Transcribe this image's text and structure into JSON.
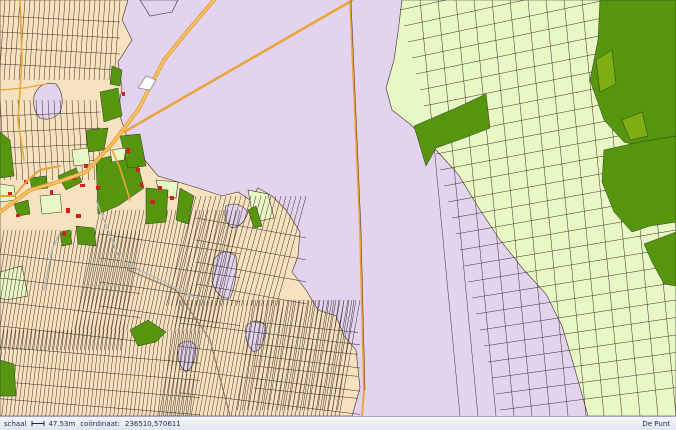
{
  "colors": {
    "water": "#e3d3ef",
    "parcel_tan": "#f6e2be",
    "parcel_light_green": "#e8f8c4",
    "parcel_dark_green": "#55960e",
    "parcel_mid_green": "#7eae0f",
    "road_orange": "#e8a53a",
    "boundary_line": "#3a2f28",
    "building_red": "#d21f1f"
  },
  "status_bar": {
    "scale_label": "schaal",
    "scale_icon": "scale-bar-icon",
    "scale_value": "47.53m",
    "coordinate_label": "coördinaat:",
    "coordinate_value": "236510,570611",
    "brand": "De Punt"
  }
}
